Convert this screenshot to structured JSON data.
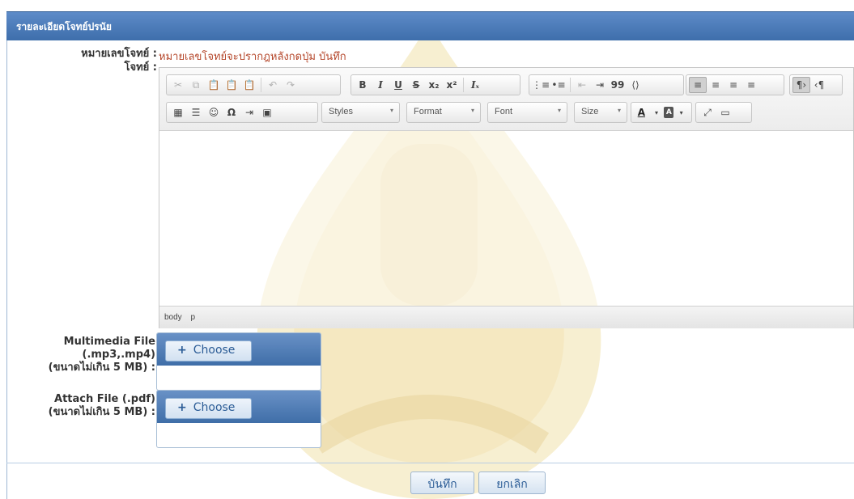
{
  "panel": {
    "title": "รายละเอียดโจทย์ปรนัย"
  },
  "form": {
    "question_no_label": "หมายเลขโจทย์ :",
    "question_no_value": "หมายเลขโจทย์จะปรากฎหลังกดปุ่ม บันทึก",
    "question_label": "โจทย์ :",
    "multimedia_label_1": "Multimedia File",
    "multimedia_label_2": "(.mp3,.mp4)",
    "multimedia_label_3": "(ขนาดไม่เกิน 5 MB) :",
    "attach_label_1": "Attach File (.pdf)",
    "attach_label_2": "(ขนาดไม่เกิน 5 MB) :",
    "choose_label": "Choose",
    "choose_plus": "+"
  },
  "editor": {
    "styles": "Styles",
    "format": "Format",
    "font": "Font",
    "size": "Size",
    "path_1": "body",
    "path_2": "p",
    "btn_bold": "B",
    "btn_italic": "I",
    "btn_underline": "U",
    "btn_strike": "S",
    "btn_sub": "x₂",
    "btn_sup": "x²",
    "btn_clear": "Iₓ",
    "btn_quote": "99",
    "btn_omega": "Ω",
    "btn_smiley": "☺",
    "btn_textcolor": "A",
    "btn_bgcolor": "A",
    "dropdown_arrow": "▾"
  },
  "actions": {
    "save": "บันทึก",
    "cancel": "ยกเลิก"
  },
  "colors": {
    "header": "#4a78b5",
    "note": "#b5472b",
    "watermark": "#f3e7c3"
  }
}
